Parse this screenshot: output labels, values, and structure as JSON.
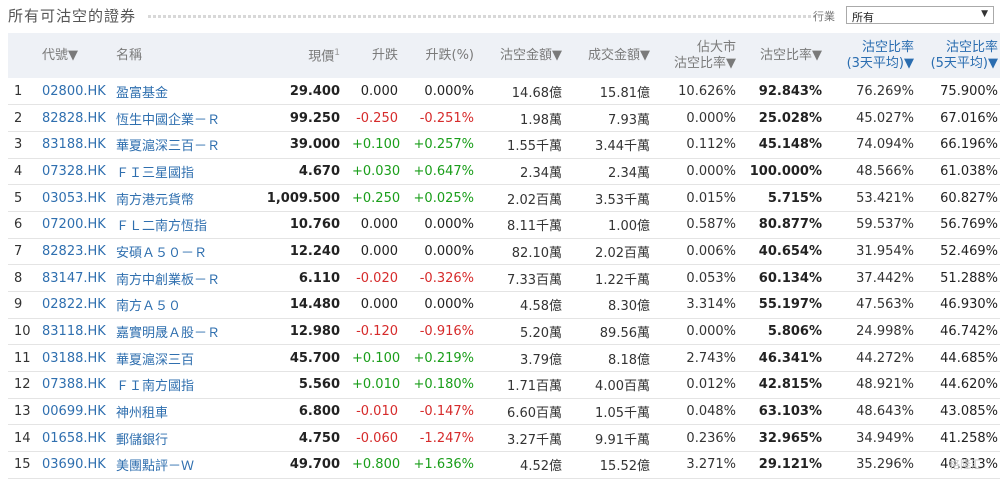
{
  "page": {
    "title": "所有可沽空的證券",
    "filter_label": "行業",
    "filter_value": "所有",
    "watermark": "格隆汇"
  },
  "headers": {
    "index": "",
    "code": "代號▼",
    "name": "名稱",
    "price": "現價",
    "price_sup": "1",
    "change": "升跌",
    "change_pct": "升跌(%)",
    "short_amount": "沽空金額▼",
    "turnover": "成交金額▼",
    "mkt_ratio_l1": "佔大市",
    "mkt_ratio_l2": "沽空比率▼",
    "short_ratio": "沽空比率▼",
    "ratio3_l1": "沽空比率",
    "ratio3_l2": "(3天平均)▼",
    "ratio5_l1": "沽空比率",
    "ratio5_l2": "(5天平均)▼"
  },
  "colors": {
    "positive": "#1a9e1a",
    "negative": "#d62b2b",
    "link": "#2f6faf",
    "header_bg": "#eef1f6"
  },
  "rows": [
    {
      "i": "1",
      "code": "02800.HK",
      "name": "盈富基金",
      "price": "29.400",
      "chg": "0.000",
      "pct": "0.000%",
      "short": "14.68億",
      "turn": "15.81億",
      "mkt": "10.626%",
      "ratio": "92.843%",
      "r3": "76.269%",
      "r5": "75.900%",
      "dir": "zero"
    },
    {
      "i": "2",
      "code": "82828.HK",
      "name": "恆生中國企業－Ｒ",
      "price": "99.250",
      "chg": "-0.250",
      "pct": "-0.251%",
      "short": "1.98萬",
      "turn": "7.93萬",
      "mkt": "0.000%",
      "ratio": "25.028%",
      "r3": "45.027%",
      "r5": "67.016%",
      "dir": "neg"
    },
    {
      "i": "3",
      "code": "83188.HK",
      "name": "華夏滬深三百－Ｒ",
      "price": "39.000",
      "chg": "+0.100",
      "pct": "+0.257%",
      "short": "1.55千萬",
      "turn": "3.44千萬",
      "mkt": "0.112%",
      "ratio": "45.148%",
      "r3": "74.094%",
      "r5": "66.196%",
      "dir": "pos"
    },
    {
      "i": "4",
      "code": "07328.HK",
      "name": "ＦＩ三星國指",
      "price": "4.670",
      "chg": "+0.030",
      "pct": "+0.647%",
      "short": "2.34萬",
      "turn": "2.34萬",
      "mkt": "0.000%",
      "ratio": "100.000%",
      "r3": "48.566%",
      "r5": "61.038%",
      "dir": "pos"
    },
    {
      "i": "5",
      "code": "03053.HK",
      "name": "南方港元貨幣",
      "price": "1,009.500",
      "chg": "+0.250",
      "pct": "+0.025%",
      "short": "2.02百萬",
      "turn": "3.53千萬",
      "mkt": "0.015%",
      "ratio": "5.715%",
      "r3": "53.421%",
      "r5": "60.827%",
      "dir": "pos"
    },
    {
      "i": "6",
      "code": "07200.HK",
      "name": "ＦＬ二南方恆指",
      "price": "10.760",
      "chg": "0.000",
      "pct": "0.000%",
      "short": "8.11千萬",
      "turn": "1.00億",
      "mkt": "0.587%",
      "ratio": "80.877%",
      "r3": "59.537%",
      "r5": "56.769%",
      "dir": "zero"
    },
    {
      "i": "7",
      "code": "82823.HK",
      "name": "安碩Ａ５０－Ｒ",
      "price": "12.240",
      "chg": "0.000",
      "pct": "0.000%",
      "short": "82.10萬",
      "turn": "2.02百萬",
      "mkt": "0.006%",
      "ratio": "40.654%",
      "r3": "31.954%",
      "r5": "52.469%",
      "dir": "zero"
    },
    {
      "i": "8",
      "code": "83147.HK",
      "name": "南方中創業板－Ｒ",
      "price": "6.110",
      "chg": "-0.020",
      "pct": "-0.326%",
      "short": "7.33百萬",
      "turn": "1.22千萬",
      "mkt": "0.053%",
      "ratio": "60.134%",
      "r3": "37.442%",
      "r5": "51.288%",
      "dir": "neg"
    },
    {
      "i": "9",
      "code": "02822.HK",
      "name": "南方Ａ５０",
      "price": "14.480",
      "chg": "0.000",
      "pct": "0.000%",
      "short": "4.58億",
      "turn": "8.30億",
      "mkt": "3.314%",
      "ratio": "55.197%",
      "r3": "47.563%",
      "r5": "46.930%",
      "dir": "zero"
    },
    {
      "i": "10",
      "code": "83118.HK",
      "name": "嘉實明晟Ａ股－Ｒ",
      "price": "12.980",
      "chg": "-0.120",
      "pct": "-0.916%",
      "short": "5.20萬",
      "turn": "89.56萬",
      "mkt": "0.000%",
      "ratio": "5.806%",
      "r3": "24.998%",
      "r5": "46.742%",
      "dir": "neg"
    },
    {
      "i": "11",
      "code": "03188.HK",
      "name": "華夏滬深三百",
      "price": "45.700",
      "chg": "+0.100",
      "pct": "+0.219%",
      "short": "3.79億",
      "turn": "8.18億",
      "mkt": "2.743%",
      "ratio": "46.341%",
      "r3": "44.272%",
      "r5": "44.685%",
      "dir": "pos"
    },
    {
      "i": "12",
      "code": "07388.HK",
      "name": "ＦＩ南方國指",
      "price": "5.560",
      "chg": "+0.010",
      "pct": "+0.180%",
      "short": "1.71百萬",
      "turn": "4.00百萬",
      "mkt": "0.012%",
      "ratio": "42.815%",
      "r3": "48.921%",
      "r5": "44.620%",
      "dir": "pos"
    },
    {
      "i": "13",
      "code": "00699.HK",
      "name": "神州租車",
      "price": "6.800",
      "chg": "-0.010",
      "pct": "-0.147%",
      "short": "6.60百萬",
      "turn": "1.05千萬",
      "mkt": "0.048%",
      "ratio": "63.103%",
      "r3": "48.643%",
      "r5": "43.085%",
      "dir": "neg"
    },
    {
      "i": "14",
      "code": "01658.HK",
      "name": "郵儲銀行",
      "price": "4.750",
      "chg": "-0.060",
      "pct": "-1.247%",
      "short": "3.27千萬",
      "turn": "9.91千萬",
      "mkt": "0.236%",
      "ratio": "32.965%",
      "r3": "34.949%",
      "r5": "41.258%",
      "dir": "neg"
    },
    {
      "i": "15",
      "code": "03690.HK",
      "name": "美團點評－Ｗ",
      "price": "49.700",
      "chg": "+0.800",
      "pct": "+1.636%",
      "short": "4.52億",
      "turn": "15.52億",
      "mkt": "3.271%",
      "ratio": "29.121%",
      "r3": "35.296%",
      "r5": "40.313%",
      "dir": "pos"
    }
  ]
}
